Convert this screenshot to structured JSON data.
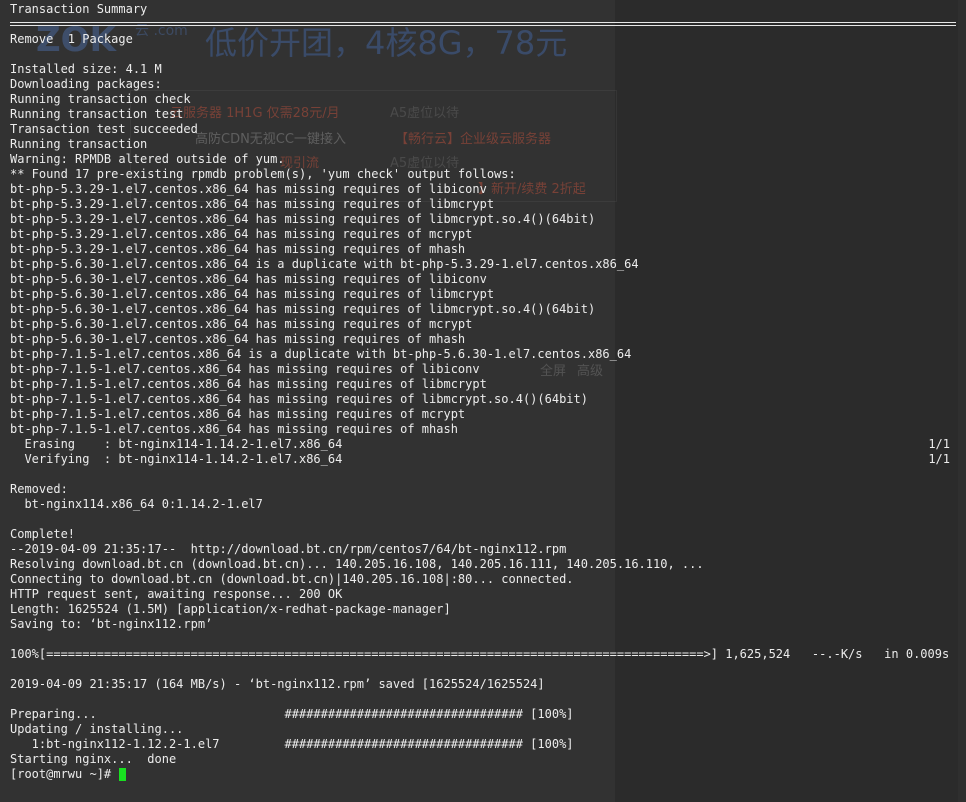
{
  "terminal": {
    "lines_top": [
      "Transaction Summary"
    ],
    "lines_body": [
      "Remove  1 Package",
      "",
      "Installed size: 4.1 M",
      "Downloading packages:",
      "Running transaction check",
      "Running transaction test",
      "Transaction test succeeded",
      "Running transaction",
      "Warning: RPMDB altered outside of yum.",
      "** Found 17 pre-existing rpmdb problem(s), 'yum check' output follows:",
      "bt-php-5.3.29-1.el7.centos.x86_64 has missing requires of libiconv",
      "bt-php-5.3.29-1.el7.centos.x86_64 has missing requires of libmcrypt",
      "bt-php-5.3.29-1.el7.centos.x86_64 has missing requires of libmcrypt.so.4()(64bit)",
      "bt-php-5.3.29-1.el7.centos.x86_64 has missing requires of mcrypt",
      "bt-php-5.3.29-1.el7.centos.x86_64 has missing requires of mhash",
      "bt-php-5.6.30-1.el7.centos.x86_64 is a duplicate with bt-php-5.3.29-1.el7.centos.x86_64",
      "bt-php-5.6.30-1.el7.centos.x86_64 has missing requires of libiconv",
      "bt-php-5.6.30-1.el7.centos.x86_64 has missing requires of libmcrypt",
      "bt-php-5.6.30-1.el7.centos.x86_64 has missing requires of libmcrypt.so.4()(64bit)",
      "bt-php-5.6.30-1.el7.centos.x86_64 has missing requires of mcrypt",
      "bt-php-5.6.30-1.el7.centos.x86_64 has missing requires of mhash",
      "bt-php-7.1.5-1.el7.centos.x86_64 is a duplicate with bt-php-5.6.30-1.el7.centos.x86_64",
      "bt-php-7.1.5-1.el7.centos.x86_64 has missing requires of libiconv",
      "bt-php-7.1.5-1.el7.centos.x86_64 has missing requires of libmcrypt",
      "bt-php-7.1.5-1.el7.centos.x86_64 has missing requires of libmcrypt.so.4()(64bit)",
      "bt-php-7.1.5-1.el7.centos.x86_64 has missing requires of mcrypt",
      "bt-php-7.1.5-1.el7.centos.x86_64 has missing requires of mhash"
    ],
    "progress_rows": [
      {
        "text": "  Erasing    : bt-nginx114-1.14.2-1.el7.x86_64",
        "count": "1/1"
      },
      {
        "text": "  Verifying  : bt-nginx114-1.14.2-1.el7.x86_64",
        "count": "1/1"
      }
    ],
    "lines_after": [
      "",
      "Removed:",
      "  bt-nginx114.x86_64 0:1.14.2-1.el7",
      "",
      "Complete!",
      "--2019-04-09 21:35:17--  http://download.bt.cn/rpm/centos7/64/bt-nginx112.rpm",
      "Resolving download.bt.cn (download.bt.cn)... 140.205.16.108, 140.205.16.111, 140.205.16.110, ...",
      "Connecting to download.bt.cn (download.bt.cn)|140.205.16.108|:80... connected.",
      "HTTP request sent, awaiting response... 200 OK",
      "Length: 1625524 (1.5M) [application/x-redhat-package-manager]",
      "Saving to: ‘bt-nginx112.rpm’",
      "",
      "100%[===========================================================================================>] 1,625,524   --.-K/s   in 0.009s",
      "",
      "2019-04-09 21:35:17 (164 MB/s) - ‘bt-nginx112.rpm’ saved [1625524/1625524]",
      "",
      "Preparing...                          ################################# [100%]",
      "Updating / installing...",
      "   1:bt-nginx112-1.12.2-1.el7         ################################# [100%]",
      "Starting nginx...  done"
    ],
    "prompt": "[root@mrwu ~]# "
  },
  "background_page": {
    "logo": "ZOK",
    "logo_sub": "云 .com",
    "hero": "低价开团，4核8G，78元",
    "ads": [
      "云服务器 1H1G 仅需28元/月",
      "A5虚位以待",
      "高防CDN无视CC一键接入",
      "【畅行云】企业级云服务器",
      "现引流",
      "A5虚位以待",
      "】新开/续费 2折起"
    ],
    "tabs": [
      "全屏",
      "高级"
    ]
  }
}
